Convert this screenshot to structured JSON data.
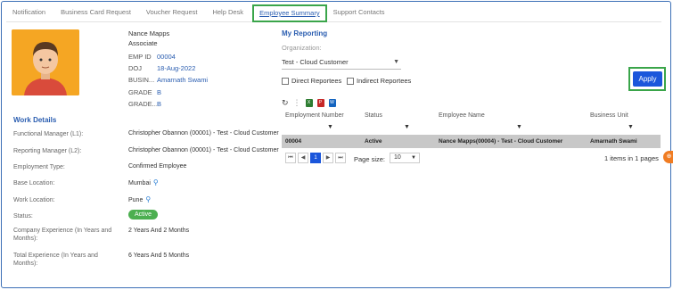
{
  "tabs": [
    {
      "label": "Notification"
    },
    {
      "label": "Business Card Request"
    },
    {
      "label": "Voucher Request"
    },
    {
      "label": "Help Desk"
    },
    {
      "label": "Employee Summary"
    },
    {
      "label": "Support Contacts"
    }
  ],
  "profile": {
    "name": "Nance Mapps",
    "role": "Associate",
    "fields": [
      {
        "key": "EMP ID",
        "value": "00004"
      },
      {
        "key": "DOJ",
        "value": "18-Aug-2022"
      },
      {
        "key": "BUSIN...",
        "value": "Amarnath Swami"
      },
      {
        "key": "GRADE",
        "value": "B"
      },
      {
        "key": "GRADE...",
        "value": "B"
      }
    ]
  },
  "work_details": {
    "title": "Work Details",
    "rows": [
      {
        "label": "Functional Manager (L1):",
        "value": "Christopher Obannon (00001) - Test - Cloud Customer"
      },
      {
        "label": "Reporting Manager (L2):",
        "value": "Christopher Obannon (00001) - Test - Cloud Customer"
      },
      {
        "label": "Employment Type:",
        "value": "Confirmed Employee"
      },
      {
        "label": "Base Location:",
        "value": "Mumbai"
      },
      {
        "label": "Work Location:",
        "value": "Pune"
      },
      {
        "label": "Status:",
        "value": "Active"
      },
      {
        "label": "Company Experience (In Years and Months):",
        "value": "2 Years And 2 Months"
      },
      {
        "label": "Total Experience (In Years and Months):",
        "value": "6 Years And 5 Months"
      }
    ]
  },
  "reporting": {
    "title": "My Reporting",
    "org_label": "Organization:",
    "org_value": "Test - Cloud Customer",
    "direct_label": "Direct Reportees",
    "indirect_label": "Indirect Reportees",
    "apply_label": "Apply"
  },
  "grid": {
    "columns": [
      "Employment Number",
      "Status",
      "Employee Name",
      "Business Unit"
    ],
    "rows": [
      [
        "00004",
        "Active",
        "Nance Mapps(00004) - Test - Cloud Customer",
        "Amarnath Swami"
      ]
    ],
    "current_page": "1",
    "page_size_label": "Page size:",
    "page_size": "10",
    "info": "1 items in 1 pages"
  },
  "colors": {
    "accent": "#2a5db0",
    "apply": "#1a56db",
    "highlight": "#3aa54a",
    "active_badge": "#4caf50",
    "avatar_bg": "#f5a623"
  }
}
